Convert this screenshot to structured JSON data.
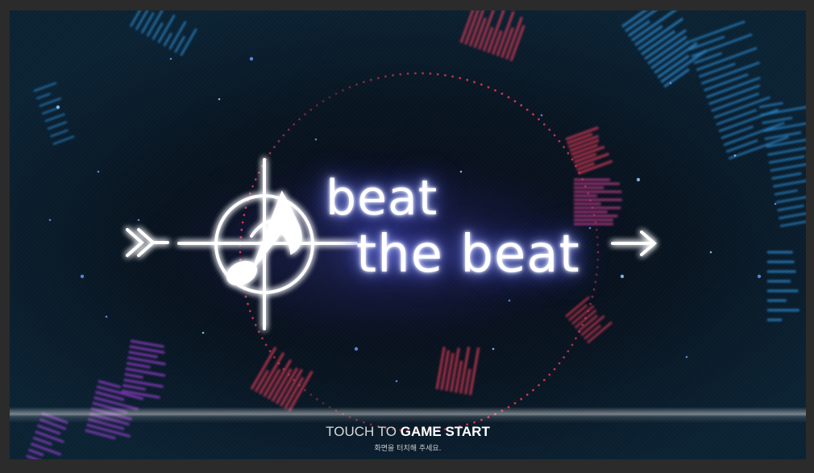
{
  "game": {
    "title_line1": "beat",
    "title_line2": "the beat"
  },
  "start_prompt": {
    "text_prefix": "TOUCH TO",
    "text_emphasis": "GAME START",
    "subtitle": "화면을 터치해 주세요."
  },
  "icons": {
    "logo_emblem": "crosshair-music-note-icon",
    "left_arrow": "double-chevron-right-icon",
    "right_arrow": "arrow-right-icon"
  },
  "colors": {
    "glow": "#7c8cff",
    "ring_red": "#e23a57",
    "equalizer_blue": "#2d8fd6",
    "equalizer_purple": "#9a3fd0"
  }
}
